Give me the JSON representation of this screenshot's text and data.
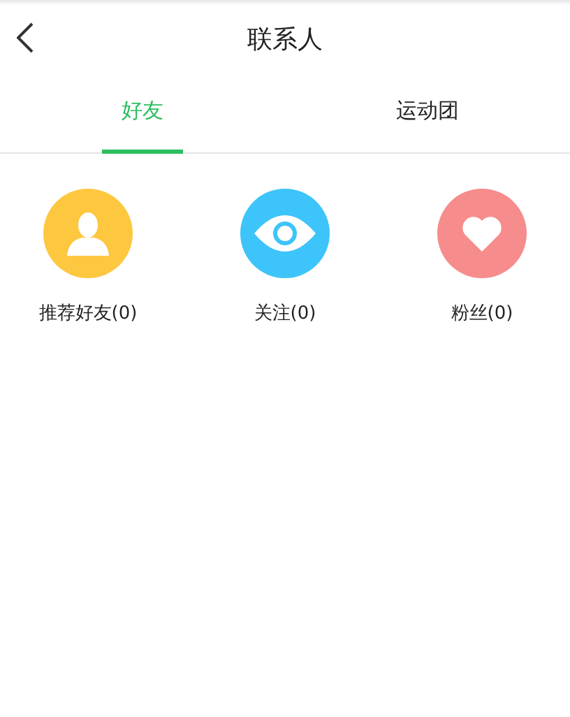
{
  "header": {
    "title": "联系人"
  },
  "tabs": [
    {
      "label": "好友",
      "selected": true
    },
    {
      "label": "运动团",
      "selected": false
    }
  ],
  "items": [
    {
      "kind": "person",
      "label": "推荐好友(0)",
      "color": "#fdc73f"
    },
    {
      "kind": "eye",
      "label": "关注(0)",
      "color": "#3dc4fa"
    },
    {
      "kind": "heart",
      "label": "粉丝(0)",
      "color": "#f68c8c"
    }
  ]
}
